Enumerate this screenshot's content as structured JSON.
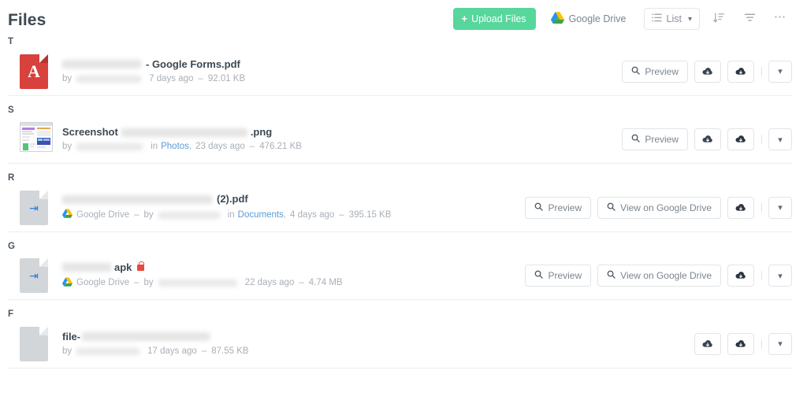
{
  "header": {
    "title": "Files",
    "upload_label": "Upload Files",
    "google_drive_label": "Google Drive",
    "view_mode_label": "List",
    "icons": {
      "plus": "plus-icon",
      "list": "list-view-icon",
      "caret": "chevron-down-icon",
      "sort": "sort-icon",
      "filter": "filter-icon",
      "more": "ellipsis-icon"
    }
  },
  "colors": {
    "accent_green": "#57d79c",
    "link_blue": "#5a9bd8",
    "pdf_red": "#d8413c",
    "lock_red": "#e8493f",
    "title_text": "#3d4852",
    "muted_text": "#a9b0b8",
    "border": "#e1e4e8"
  },
  "labels": {
    "preview": "Preview",
    "view_on_google_drive": "View on Google Drive",
    "by": "by",
    "in": "in",
    "dash": "–",
    "download": "download-icon",
    "download_locked": "download-locked-icon",
    "expand": "chevron-down-icon"
  },
  "groups": [
    {
      "letter": "T",
      "files": [
        {
          "icon": "pdf-file-icon",
          "name_prefix_redacted": true,
          "name": "- Google Forms.pdf",
          "locked": false,
          "source": null,
          "author_redacted": true,
          "folder": null,
          "modified": "7 days ago",
          "size": "92.01 KB",
          "actions": [
            "preview",
            "download",
            "download",
            "expand"
          ]
        }
      ]
    },
    {
      "letter": "S",
      "files": [
        {
          "icon": "image-thumbnail",
          "name_prefix": "Screenshot",
          "name_redacted_middle": true,
          "name": ".png",
          "locked": false,
          "source": null,
          "author_redacted": true,
          "folder": "Photos",
          "modified": "23 days ago",
          "size": "476.21 KB",
          "actions": [
            "preview",
            "download",
            "download",
            "expand"
          ]
        }
      ]
    },
    {
      "letter": "R",
      "files": [
        {
          "icon": "google-drive-shortcut-icon",
          "name_prefix_redacted": true,
          "name": "(2).pdf",
          "locked": false,
          "source": "Google Drive",
          "author_redacted": true,
          "folder": "Documents",
          "modified": "4 days ago",
          "size": "395.15 KB",
          "actions": [
            "preview",
            "view_on_google_drive",
            "download",
            "expand"
          ]
        }
      ]
    },
    {
      "letter": "G",
      "files": [
        {
          "icon": "google-drive-shortcut-icon",
          "name_prefix_redacted": true,
          "name": "apk",
          "locked": true,
          "source": "Google Drive",
          "author_redacted": true,
          "folder": null,
          "modified": "22 days ago",
          "size": "4.74 MB",
          "actions": [
            "preview",
            "view_on_google_drive",
            "download",
            "expand"
          ]
        }
      ]
    },
    {
      "letter": "F",
      "files": [
        {
          "icon": "generic-file-icon",
          "name_prefix": "file-",
          "name_redacted_suffix": true,
          "name": "",
          "locked": false,
          "source": null,
          "author_redacted": true,
          "folder": null,
          "modified": "17 days ago",
          "size": "87.55 KB",
          "actions": [
            "download",
            "download",
            "expand"
          ]
        }
      ]
    }
  ]
}
